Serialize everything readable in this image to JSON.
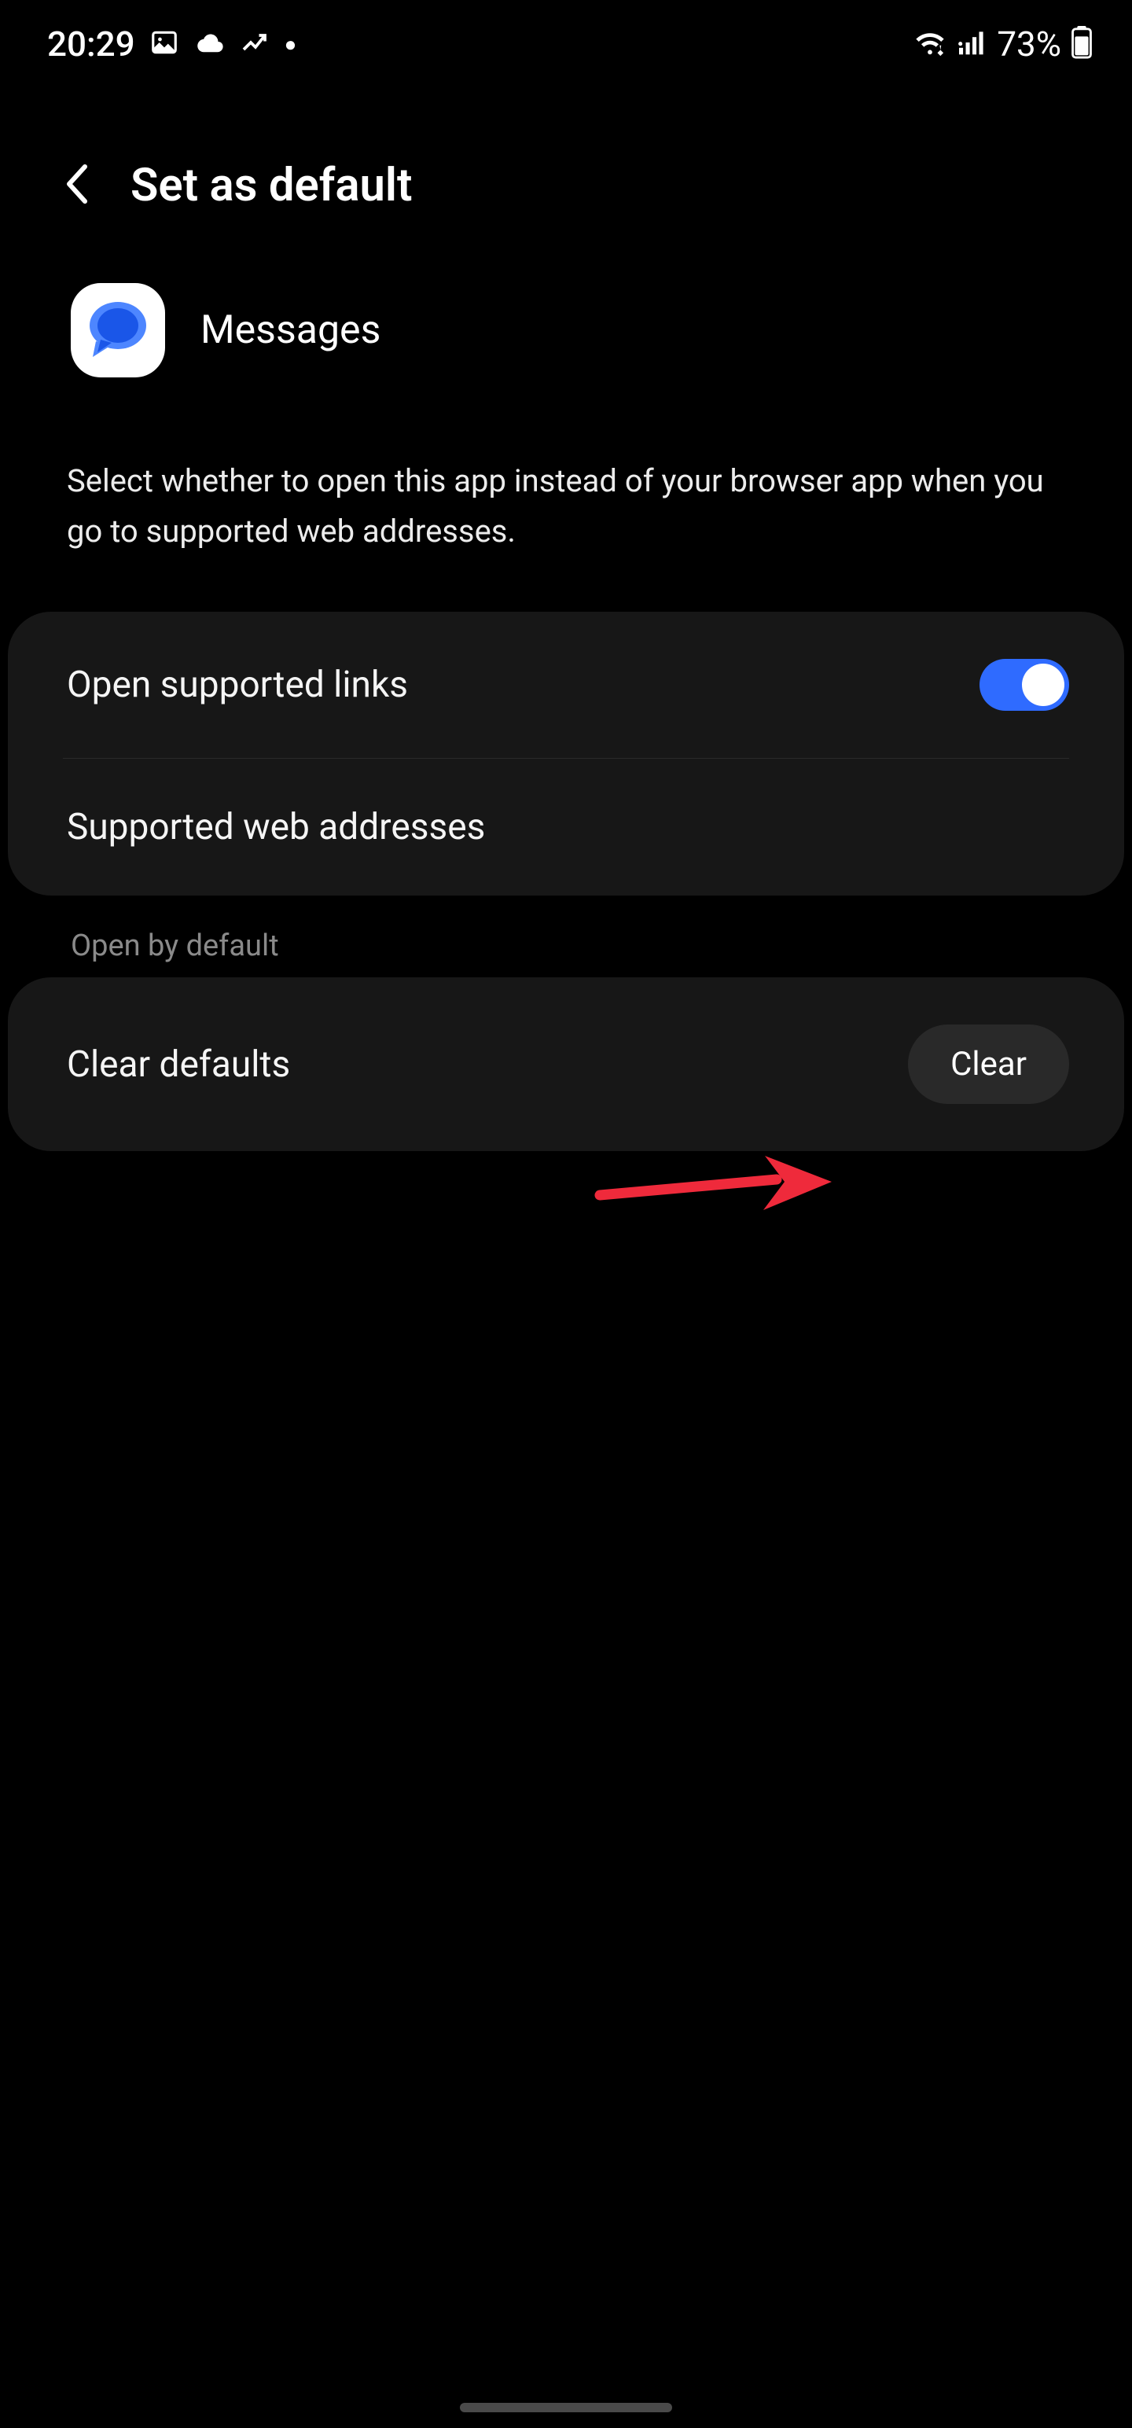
{
  "status": {
    "time": "20:29",
    "battery": "73%"
  },
  "header": {
    "title": "Set as default"
  },
  "app": {
    "name": "Messages"
  },
  "description": "Select whether to open this app instead of your browser app when you go to supported web addresses.",
  "settings": {
    "open_links_label": "Open supported links",
    "supported_addresses_label": "Supported web addresses"
  },
  "section_header": "Open by default",
  "clear_defaults": {
    "label": "Clear defaults",
    "button": "Clear"
  }
}
